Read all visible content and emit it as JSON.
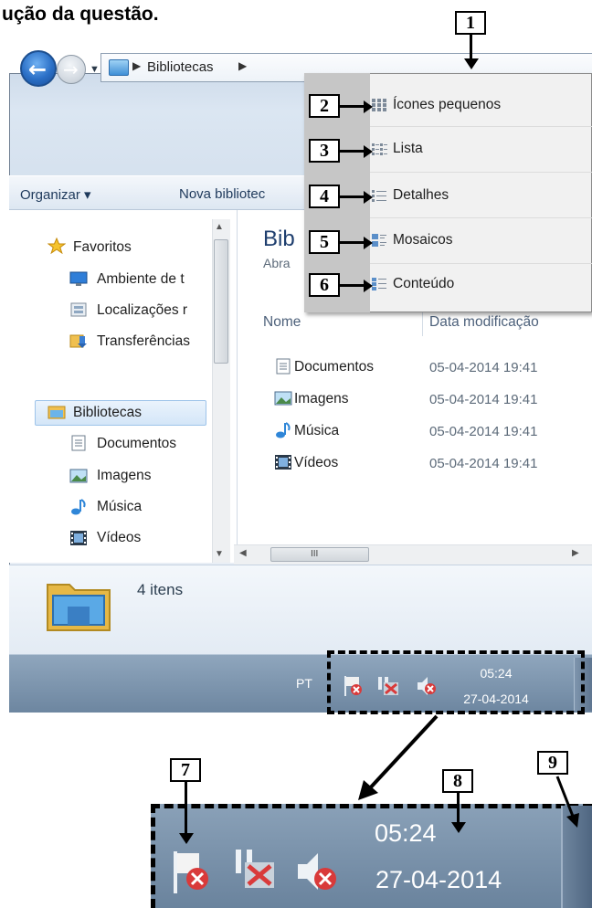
{
  "heading": "ução da questão.",
  "window": {
    "breadcrumb": [
      "Bibliotecas"
    ],
    "toolbar": [
      "Organizar ▾",
      "Nova bibliotec"
    ],
    "nav": {
      "favorites_label": "Favoritos",
      "favorites": [
        "Ambiente de t",
        "Localizações r",
        "Transferências"
      ],
      "libraries_label": "Bibliotecas",
      "libraries": [
        "Documentos",
        "Imagens",
        "Música",
        "Vídeos"
      ]
    },
    "content": {
      "title": "Bib",
      "subtitle": "Abra",
      "col_name": "Nome",
      "col_date": "Data modificação",
      "rows": [
        {
          "name": "Documentos",
          "date": "05-04-2014 19:41"
        },
        {
          "name": "Imagens",
          "date": "05-04-2014 19:41"
        },
        {
          "name": "Música",
          "date": "05-04-2014 19:41"
        },
        {
          "name": "Vídeos",
          "date": "05-04-2014 19:41"
        }
      ]
    },
    "status": "4 itens",
    "scroll_glyph": "III"
  },
  "menu": {
    "items": [
      "Ícones pequenos",
      "Lista",
      "Detalhes",
      "Mosaicos",
      "Conteúdo"
    ]
  },
  "taskbar": {
    "lang": "PT",
    "time": "05:24",
    "date": "27-04-2014"
  },
  "zoom": {
    "time": "05:24",
    "date": "27-04-2014"
  },
  "callouts": [
    "1",
    "2",
    "3",
    "4",
    "5",
    "6",
    "7",
    "8",
    "9"
  ],
  "icons": [
    "back-arrow-icon",
    "forward-arrow-icon",
    "library-folder-icon",
    "star-icon",
    "desktop-icon",
    "network-places-icon",
    "downloads-icon",
    "document-icon",
    "pictures-icon",
    "music-note-icon",
    "video-film-icon",
    "small-icons-view-icon",
    "list-view-icon",
    "details-view-icon",
    "tiles-view-icon",
    "content-view-icon",
    "action-center-flag-icon",
    "network-disconnected-icon",
    "volume-muted-icon"
  ],
  "colors": {
    "accent": "#1e3e6e",
    "taskbar": "#7a92ab",
    "menu_rail": "#c6c6c6"
  }
}
